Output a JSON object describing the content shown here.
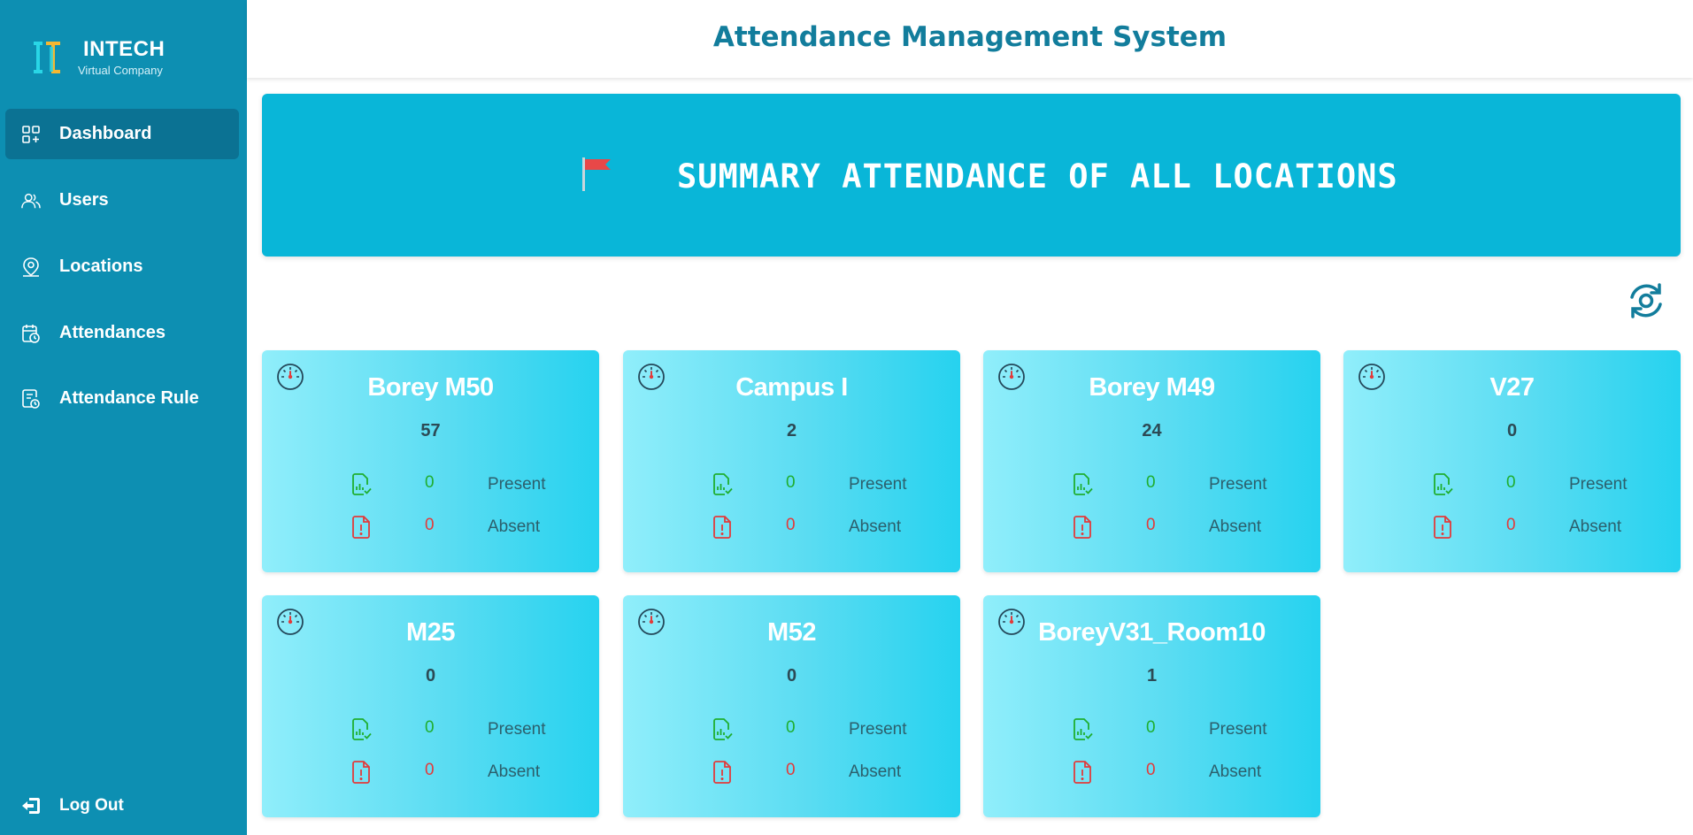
{
  "brand": {
    "name": "INTECH",
    "subtitle": "Virtual Company"
  },
  "sidebar": {
    "items": [
      {
        "label": "Dashboard",
        "icon": "dashboard-grid-icon",
        "active": true
      },
      {
        "label": "Users",
        "icon": "users-icon",
        "active": false
      },
      {
        "label": "Locations",
        "icon": "location-pin-icon",
        "active": false
      },
      {
        "label": "Attendances",
        "icon": "calendar-clock-icon",
        "active": false
      },
      {
        "label": "Attendance Rule",
        "icon": "rule-clock-icon",
        "active": false
      }
    ],
    "logout": "Log Out"
  },
  "header": {
    "title": "Attendance Management System"
  },
  "banner": {
    "title": "SUMMARY ATTENDANCE OF ALL LOCATIONS",
    "icon": "red-flag-icon"
  },
  "toolbar": {
    "refresh_icon": "refresh-icon"
  },
  "labels": {
    "present": "Present",
    "absent": "Absent"
  },
  "colors": {
    "sidebar": "#0d8fb2",
    "banner": "#09b6d8",
    "title": "#127d9c",
    "present": "#1fae2f",
    "absent": "#e23b3b"
  },
  "locations": [
    {
      "name": "Borey M50",
      "total": "57",
      "present": "0",
      "absent": "0"
    },
    {
      "name": "Campus I",
      "total": "2",
      "present": "0",
      "absent": "0"
    },
    {
      "name": "Borey M49",
      "total": "24",
      "present": "0",
      "absent": "0"
    },
    {
      "name": "V27",
      "total": "0",
      "present": "0",
      "absent": "0"
    },
    {
      "name": "M25",
      "total": "0",
      "present": "0",
      "absent": "0"
    },
    {
      "name": "M52",
      "total": "0",
      "present": "0",
      "absent": "0"
    },
    {
      "name": "BoreyV31_Room10",
      "total": "1",
      "present": "0",
      "absent": "0"
    }
  ]
}
